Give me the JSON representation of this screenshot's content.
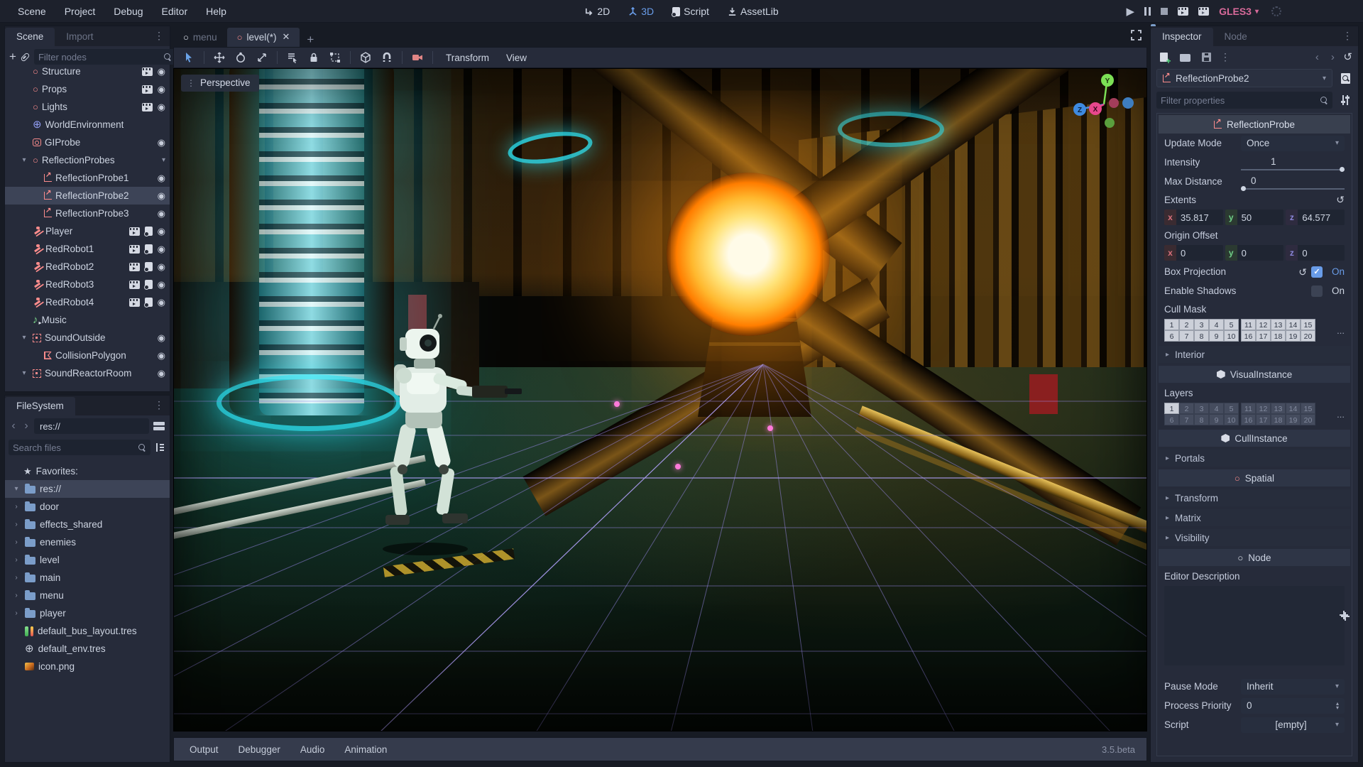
{
  "app": {
    "renderer": "GLES3",
    "version": "3.5.beta"
  },
  "menu_bar": {
    "items": [
      "Scene",
      "Project",
      "Debug",
      "Editor",
      "Help"
    ],
    "workspaces": [
      {
        "label": "2D",
        "active": false
      },
      {
        "label": "3D",
        "active": true
      },
      {
        "label": "Script",
        "active": false
      },
      {
        "label": "AssetLib",
        "active": false
      }
    ],
    "playback_icons": [
      "play",
      "pause",
      "stop",
      "play-scene",
      "play-custom-scene",
      "loading-spinner"
    ]
  },
  "scene_dock": {
    "tabs": [
      {
        "label": "Scene",
        "active": true
      },
      {
        "label": "Import",
        "active": false
      }
    ],
    "filter_placeholder": "Filter nodes",
    "toolbar_icons": [
      "add-node",
      "instance-scene",
      "search",
      "attach-script"
    ],
    "tree": [
      {
        "label": "Structure",
        "icon": "spatial",
        "depth": 1,
        "trail": [
          "movie",
          "eye"
        ],
        "clipped": true
      },
      {
        "label": "Props",
        "icon": "spatial",
        "depth": 1,
        "trail": [
          "movie",
          "eye"
        ]
      },
      {
        "label": "Lights",
        "icon": "spatial",
        "depth": 1,
        "trail": [
          "movie",
          "eye"
        ]
      },
      {
        "label": "WorldEnvironment",
        "icon": "world-environment",
        "depth": 1,
        "trail": []
      },
      {
        "label": "GIProbe",
        "icon": "gi-probe",
        "depth": 1,
        "trail": [
          "eye"
        ]
      },
      {
        "label": "ReflectionProbes",
        "icon": "spatial",
        "depth": 1,
        "expander": "open",
        "trail": [
          "collapse"
        ]
      },
      {
        "label": "ReflectionProbe1",
        "icon": "reflection-probe",
        "depth": 2,
        "trail": [
          "eye"
        ]
      },
      {
        "label": "ReflectionProbe2",
        "icon": "reflection-probe",
        "depth": 2,
        "trail": [
          "eye"
        ],
        "selected": true
      },
      {
        "label": "ReflectionProbe3",
        "icon": "reflection-probe",
        "depth": 2,
        "trail": [
          "eye"
        ]
      },
      {
        "label": "Player",
        "icon": "character",
        "depth": 1,
        "trail": [
          "movie",
          "script",
          "eye"
        ]
      },
      {
        "label": "RedRobot1",
        "icon": "character",
        "depth": 1,
        "trail": [
          "movie",
          "script",
          "eye"
        ]
      },
      {
        "label": "RedRobot2",
        "icon": "character",
        "depth": 1,
        "trail": [
          "movie",
          "script",
          "eye"
        ]
      },
      {
        "label": "RedRobot3",
        "icon": "character",
        "depth": 1,
        "trail": [
          "movie",
          "script",
          "eye"
        ]
      },
      {
        "label": "RedRobot4",
        "icon": "character",
        "depth": 1,
        "trail": [
          "movie",
          "script",
          "eye"
        ]
      },
      {
        "label": "Music",
        "icon": "audio-player",
        "depth": 1,
        "trail": []
      },
      {
        "label": "SoundOutside",
        "icon": "area",
        "depth": 1,
        "expander": "open",
        "trail": [
          "eye"
        ]
      },
      {
        "label": "CollisionPolygon",
        "icon": "collision-polygon",
        "depth": 2,
        "trail": [
          "eye"
        ]
      },
      {
        "label": "SoundReactorRoom",
        "icon": "area",
        "depth": 1,
        "expander": "open",
        "trail": [
          "eye"
        ]
      }
    ]
  },
  "filesystem_dock": {
    "tab": "FileSystem",
    "path": "res://",
    "search_placeholder": "Search files",
    "favorites_label": "Favorites:",
    "items": [
      {
        "label": "res://",
        "icon": "folder",
        "expander": "open",
        "selected": true
      },
      {
        "label": "door",
        "icon": "folder",
        "expander": "closed"
      },
      {
        "label": "effects_shared",
        "icon": "folder",
        "expander": "closed"
      },
      {
        "label": "enemies",
        "icon": "folder",
        "expander": "closed"
      },
      {
        "label": "level",
        "icon": "folder",
        "expander": "closed"
      },
      {
        "label": "main",
        "icon": "folder",
        "expander": "closed"
      },
      {
        "label": "menu",
        "icon": "folder",
        "expander": "closed"
      },
      {
        "label": "player",
        "icon": "folder",
        "expander": "closed"
      },
      {
        "label": "default_bus_layout.tres",
        "icon": "audio-bus"
      },
      {
        "label": "default_env.tres",
        "icon": "environment"
      },
      {
        "label": "icon.png",
        "icon": "image"
      }
    ]
  },
  "viewport": {
    "tabs": [
      {
        "label": "menu",
        "active": false
      },
      {
        "label": "level(*)",
        "active": true,
        "closable": true
      }
    ],
    "toolbar_icons": [
      "select-tool",
      "move-tool",
      "rotate-tool",
      "scale-tool",
      "list-select-tool",
      "lock-object",
      "group-object",
      "snap-object",
      "use-snap",
      "preview-camera"
    ],
    "toolbar_menus": [
      "Transform",
      "View"
    ],
    "perspective_label": "Perspective",
    "axis_gizmo": {
      "x_color": "#e8478b",
      "y_color": "#7ce055",
      "z_color": "#3e8ae0"
    },
    "bottom_tabs": [
      "Output",
      "Debugger",
      "Audio",
      "Animation"
    ],
    "version": "3.5.beta"
  },
  "inspector": {
    "tabs": [
      {
        "label": "Inspector",
        "active": true
      },
      {
        "label": "Node",
        "active": false
      }
    ],
    "toolbar_icons": [
      "new-resource",
      "load-resource",
      "save-resource",
      "more-options",
      "history-back",
      "history-forward",
      "object-history"
    ],
    "node_name": "ReflectionProbe2",
    "filter_placeholder": "Filter properties",
    "section_headers": {
      "reflection_probe": "ReflectionProbe",
      "visual_instance": "VisualInstance",
      "cull_instance": "CullInstance",
      "spatial": "Spatial",
      "node": "Node"
    },
    "properties": {
      "update_mode": {
        "label": "Update Mode",
        "value": "Once"
      },
      "intensity": {
        "label": "Intensity",
        "value": "1"
      },
      "max_distance": {
        "label": "Max Distance",
        "value": "0"
      },
      "extents": {
        "label": "Extents",
        "x": "35.817",
        "y": "50",
        "z": "64.577"
      },
      "origin_offset": {
        "label": "Origin Offset",
        "x": "0",
        "y": "0",
        "z": "0"
      },
      "box_projection": {
        "label": "Box Projection",
        "value": "On",
        "checked": true
      },
      "enable_shadows": {
        "label": "Enable Shadows",
        "value": "On",
        "checked": false
      },
      "cull_mask": {
        "label": "Cull Mask",
        "rows": [
          [
            1,
            2,
            3,
            4,
            5
          ],
          [
            6,
            7,
            8,
            9,
            10
          ],
          [
            11,
            12,
            13,
            14,
            15
          ],
          [
            16,
            17,
            18,
            19,
            20
          ]
        ],
        "enabled": [
          1,
          2,
          3,
          4,
          5,
          6,
          7,
          8,
          9,
          10,
          11,
          12,
          13,
          14,
          15,
          16,
          17,
          18,
          19,
          20
        ]
      },
      "interior": {
        "label": "Interior"
      },
      "layers": {
        "label": "Layers",
        "enabled": [
          1
        ]
      },
      "portals": {
        "label": "Portals"
      },
      "transform": {
        "label": "Transform"
      },
      "matrix": {
        "label": "Matrix"
      },
      "visibility": {
        "label": "Visibility"
      },
      "editor_description": {
        "label": "Editor Description",
        "value": ""
      },
      "pause_mode": {
        "label": "Pause Mode",
        "value": "Inherit"
      },
      "process_priority": {
        "label": "Process Priority",
        "value": "0"
      },
      "script": {
        "label": "Script",
        "value": "[empty]"
      }
    }
  }
}
